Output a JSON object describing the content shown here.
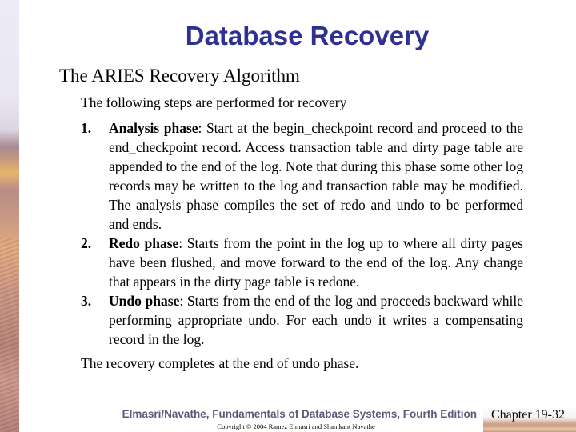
{
  "slide": {
    "title": "Database Recovery",
    "subtitle": "The ARIES Recovery Algorithm",
    "intro": "The following steps are performed for recovery",
    "steps": [
      {
        "number": "1.",
        "name": "Analysis phase",
        "text": ": Start at the begin_checkpoint record and proceed to the end_checkpoint record.  Access transaction table and dirty page table are appended to the end of the log.  Note that during this phase some other log records may be written to the log and transaction table may be modified.  The analysis phase compiles the set of redo and undo to be performed and ends."
      },
      {
        "number": "2.",
        "name": "Redo phase",
        "text": ": Starts from the point in the log up to where all dirty pages have been flushed, and move forward to the end of the log.  Any change that appears in the dirty page table is redone."
      },
      {
        "number": "3.",
        "name": "Undo phase",
        "text": ": Starts from the end of the log and proceeds backward while performing appropriate undo.  For each undo it writes a compensating record in the log."
      }
    ],
    "closing": "The recovery completes at the end of undo phase."
  },
  "footer": {
    "credit": "Elmasri/Navathe, Fundamentals of Database Systems, Fourth Edition",
    "copyright": "Copyright © 2004 Ramez Elmasri and Shamkant Navathe",
    "chapter": "Chapter 19-32"
  },
  "colors": {
    "title": "#2e3192",
    "footer_credit": "#5a5a78"
  }
}
